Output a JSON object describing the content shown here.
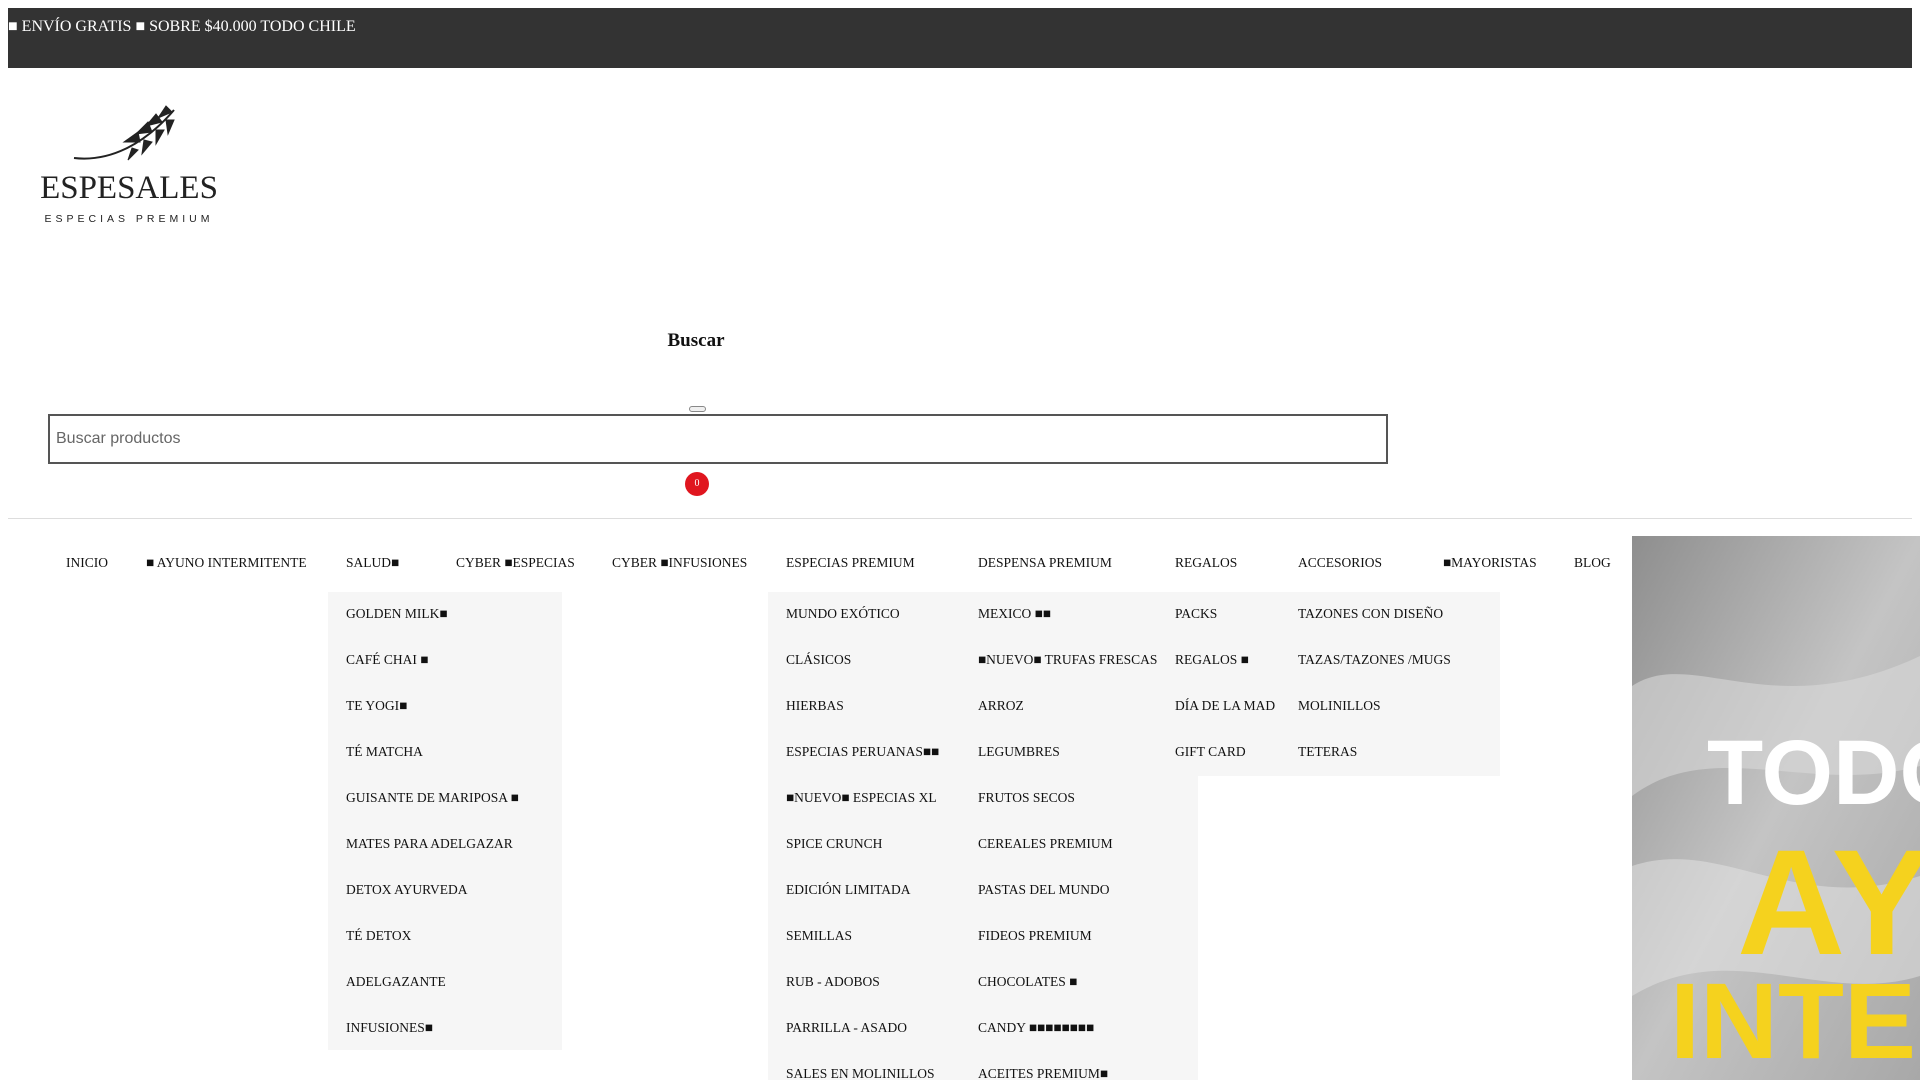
{
  "announcement": "■ ENVÍO GRATIS ■ SOBRE $40.000 TODO CHILE",
  "logo": {
    "brand": "ESPESALES",
    "tagline": "ESPECIAS PREMIUM"
  },
  "search": {
    "title": "Buscar",
    "placeholder": "Buscar productos"
  },
  "cart": {
    "count": "0"
  },
  "nav": [
    {
      "label": "INICIO"
    },
    {
      "label": "■ AYUNO INTERMITENTE"
    },
    {
      "label": "SALUD■"
    },
    {
      "label": "CYBER ■ESPECIAS"
    },
    {
      "label": "CYBER ■INFUSIONES"
    },
    {
      "label": "ESPECIAS PREMIUM"
    },
    {
      "label": "DESPENSA PREMIUM"
    },
    {
      "label": "REGALOS"
    },
    {
      "label": "ACCESORIOS"
    },
    {
      "label": "■MAYORISTAS"
    },
    {
      "label": "BLOG"
    }
  ],
  "dropdowns": {
    "salud": [
      "GOLDEN MILK■",
      "CAFÉ CHAI ■",
      "TE YOGI■",
      "TÉ MATCHA",
      "GUISANTE DE MARIPOSA ■",
      "MATES PARA ADELGAZAR",
      "DETOX AYURVEDA",
      "TÉ DETOX",
      "ADELGAZANTE",
      "INFUSIONES■"
    ],
    "especias": [
      "MUNDO EXÓTICO",
      "CLÁSICOS",
      "HIERBAS",
      "ESPECIAS PERUANAS■■",
      "■NUEVO■ ESPECIAS XL",
      "SPICE CRUNCH",
      "EDICIÓN LIMITADA",
      "SEMILLAS",
      "RUB - ADOBOS",
      "PARRILLA - ASADO",
      "SALES EN MOLINILLOS"
    ],
    "despensa": [
      "MEXICO ■■",
      "■NUEVO■ TRUFAS FRESCAS",
      "ARROZ",
      "LEGUMBRES",
      "FRUTOS SECOS",
      "CEREALES PREMIUM",
      "PASTAS DEL MUNDO",
      "FIDEOS PREMIUM",
      "CHOCOLATES ■",
      "CANDY ■■■■■■■■",
      "ACEITES PREMIUM■"
    ],
    "regalos": [
      "PACKS",
      "REGALOS ■",
      "DÍA DE LA MAD",
      "GIFT CARD"
    ],
    "accesorios": [
      "TAZONES CON DISEÑO",
      "TAZAS/TAZONES /MUGS",
      "MOLINILLOS",
      "TETERAS"
    ]
  },
  "banner": {
    "line1": "TODO",
    "line2": "AY",
    "line3": "INTE",
    "accent": "#f5d21e"
  },
  "colors": {
    "topbar": "#333333",
    "badge": "#e0161f",
    "dropdown_bg": "#f6f6f6"
  }
}
